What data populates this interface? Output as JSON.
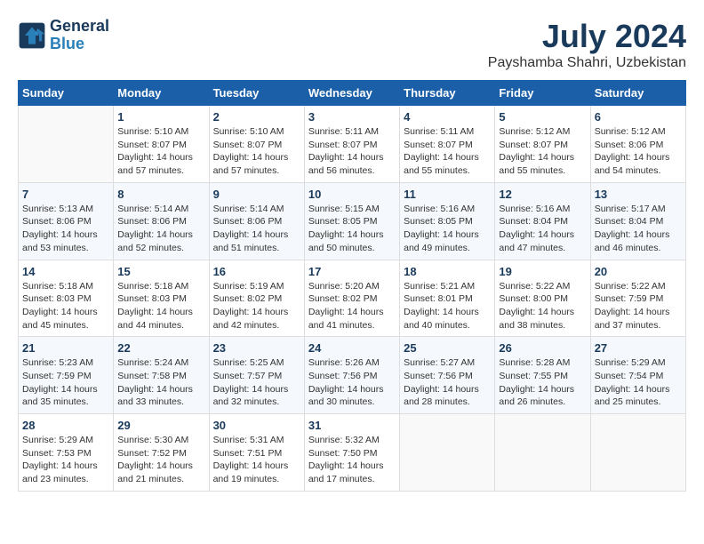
{
  "logo": {
    "line1": "General",
    "line2": "Blue"
  },
  "title": "July 2024",
  "location": "Payshamba Shahri, Uzbekistan",
  "days_of_week": [
    "Sunday",
    "Monday",
    "Tuesday",
    "Wednesday",
    "Thursday",
    "Friday",
    "Saturday"
  ],
  "weeks": [
    [
      {
        "day": "",
        "info": ""
      },
      {
        "day": "1",
        "info": "Sunrise: 5:10 AM\nSunset: 8:07 PM\nDaylight: 14 hours\nand 57 minutes."
      },
      {
        "day": "2",
        "info": "Sunrise: 5:10 AM\nSunset: 8:07 PM\nDaylight: 14 hours\nand 57 minutes."
      },
      {
        "day": "3",
        "info": "Sunrise: 5:11 AM\nSunset: 8:07 PM\nDaylight: 14 hours\nand 56 minutes."
      },
      {
        "day": "4",
        "info": "Sunrise: 5:11 AM\nSunset: 8:07 PM\nDaylight: 14 hours\nand 55 minutes."
      },
      {
        "day": "5",
        "info": "Sunrise: 5:12 AM\nSunset: 8:07 PM\nDaylight: 14 hours\nand 55 minutes."
      },
      {
        "day": "6",
        "info": "Sunrise: 5:12 AM\nSunset: 8:06 PM\nDaylight: 14 hours\nand 54 minutes."
      }
    ],
    [
      {
        "day": "7",
        "info": "Sunrise: 5:13 AM\nSunset: 8:06 PM\nDaylight: 14 hours\nand 53 minutes."
      },
      {
        "day": "8",
        "info": "Sunrise: 5:14 AM\nSunset: 8:06 PM\nDaylight: 14 hours\nand 52 minutes."
      },
      {
        "day": "9",
        "info": "Sunrise: 5:14 AM\nSunset: 8:06 PM\nDaylight: 14 hours\nand 51 minutes."
      },
      {
        "day": "10",
        "info": "Sunrise: 5:15 AM\nSunset: 8:05 PM\nDaylight: 14 hours\nand 50 minutes."
      },
      {
        "day": "11",
        "info": "Sunrise: 5:16 AM\nSunset: 8:05 PM\nDaylight: 14 hours\nand 49 minutes."
      },
      {
        "day": "12",
        "info": "Sunrise: 5:16 AM\nSunset: 8:04 PM\nDaylight: 14 hours\nand 47 minutes."
      },
      {
        "day": "13",
        "info": "Sunrise: 5:17 AM\nSunset: 8:04 PM\nDaylight: 14 hours\nand 46 minutes."
      }
    ],
    [
      {
        "day": "14",
        "info": "Sunrise: 5:18 AM\nSunset: 8:03 PM\nDaylight: 14 hours\nand 45 minutes."
      },
      {
        "day": "15",
        "info": "Sunrise: 5:18 AM\nSunset: 8:03 PM\nDaylight: 14 hours\nand 44 minutes."
      },
      {
        "day": "16",
        "info": "Sunrise: 5:19 AM\nSunset: 8:02 PM\nDaylight: 14 hours\nand 42 minutes."
      },
      {
        "day": "17",
        "info": "Sunrise: 5:20 AM\nSunset: 8:02 PM\nDaylight: 14 hours\nand 41 minutes."
      },
      {
        "day": "18",
        "info": "Sunrise: 5:21 AM\nSunset: 8:01 PM\nDaylight: 14 hours\nand 40 minutes."
      },
      {
        "day": "19",
        "info": "Sunrise: 5:22 AM\nSunset: 8:00 PM\nDaylight: 14 hours\nand 38 minutes."
      },
      {
        "day": "20",
        "info": "Sunrise: 5:22 AM\nSunset: 7:59 PM\nDaylight: 14 hours\nand 37 minutes."
      }
    ],
    [
      {
        "day": "21",
        "info": "Sunrise: 5:23 AM\nSunset: 7:59 PM\nDaylight: 14 hours\nand 35 minutes."
      },
      {
        "day": "22",
        "info": "Sunrise: 5:24 AM\nSunset: 7:58 PM\nDaylight: 14 hours\nand 33 minutes."
      },
      {
        "day": "23",
        "info": "Sunrise: 5:25 AM\nSunset: 7:57 PM\nDaylight: 14 hours\nand 32 minutes."
      },
      {
        "day": "24",
        "info": "Sunrise: 5:26 AM\nSunset: 7:56 PM\nDaylight: 14 hours\nand 30 minutes."
      },
      {
        "day": "25",
        "info": "Sunrise: 5:27 AM\nSunset: 7:56 PM\nDaylight: 14 hours\nand 28 minutes."
      },
      {
        "day": "26",
        "info": "Sunrise: 5:28 AM\nSunset: 7:55 PM\nDaylight: 14 hours\nand 26 minutes."
      },
      {
        "day": "27",
        "info": "Sunrise: 5:29 AM\nSunset: 7:54 PM\nDaylight: 14 hours\nand 25 minutes."
      }
    ],
    [
      {
        "day": "28",
        "info": "Sunrise: 5:29 AM\nSunset: 7:53 PM\nDaylight: 14 hours\nand 23 minutes."
      },
      {
        "day": "29",
        "info": "Sunrise: 5:30 AM\nSunset: 7:52 PM\nDaylight: 14 hours\nand 21 minutes."
      },
      {
        "day": "30",
        "info": "Sunrise: 5:31 AM\nSunset: 7:51 PM\nDaylight: 14 hours\nand 19 minutes."
      },
      {
        "day": "31",
        "info": "Sunrise: 5:32 AM\nSunset: 7:50 PM\nDaylight: 14 hours\nand 17 minutes."
      },
      {
        "day": "",
        "info": ""
      },
      {
        "day": "",
        "info": ""
      },
      {
        "day": "",
        "info": ""
      }
    ]
  ]
}
